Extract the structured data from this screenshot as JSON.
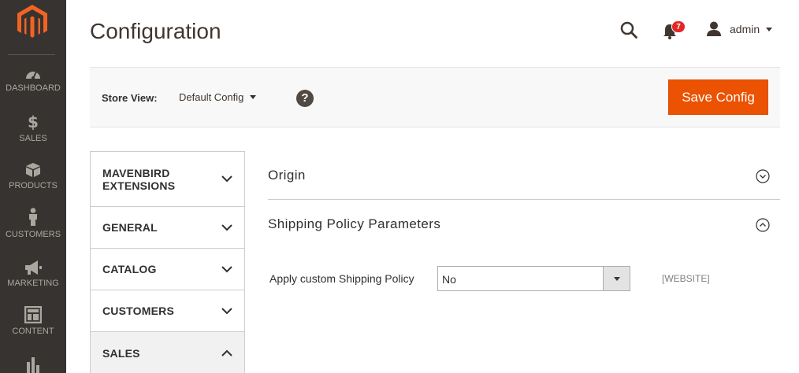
{
  "nav": {
    "items": [
      {
        "label": "DASHBOARD",
        "icon": "dashboard-icon"
      },
      {
        "label": "SALES",
        "icon": "dollar-icon"
      },
      {
        "label": "PRODUCTS",
        "icon": "box-icon"
      },
      {
        "label": "CUSTOMERS",
        "icon": "person-icon"
      },
      {
        "label": "MARKETING",
        "icon": "megaphone-icon"
      },
      {
        "label": "CONTENT",
        "icon": "layout-icon"
      },
      {
        "label": "",
        "icon": "bar-chart-icon"
      }
    ]
  },
  "header": {
    "title": "Configuration",
    "notifications_count": "7",
    "user_name": "admin"
  },
  "store_bar": {
    "label": "Store View:",
    "selected": "Default Config",
    "help": "?",
    "save_label": "Save Config"
  },
  "tabs": [
    {
      "label": "MAVENBIRD EXTENSIONS",
      "expanded": false
    },
    {
      "label": "GENERAL",
      "expanded": false
    },
    {
      "label": "CATALOG",
      "expanded": false
    },
    {
      "label": "CUSTOMERS",
      "expanded": false
    },
    {
      "label": "SALES",
      "expanded": true
    }
  ],
  "sections": [
    {
      "title": "Origin",
      "expanded": false
    },
    {
      "title": "Shipping Policy Parameters",
      "expanded": true
    }
  ],
  "field": {
    "label": "Apply custom Shipping Policy",
    "value": "No",
    "scope": "[WEBSITE]"
  },
  "colors": {
    "nav_bg": "#373330",
    "accent": "#eb5202",
    "badge": "#e22626"
  }
}
